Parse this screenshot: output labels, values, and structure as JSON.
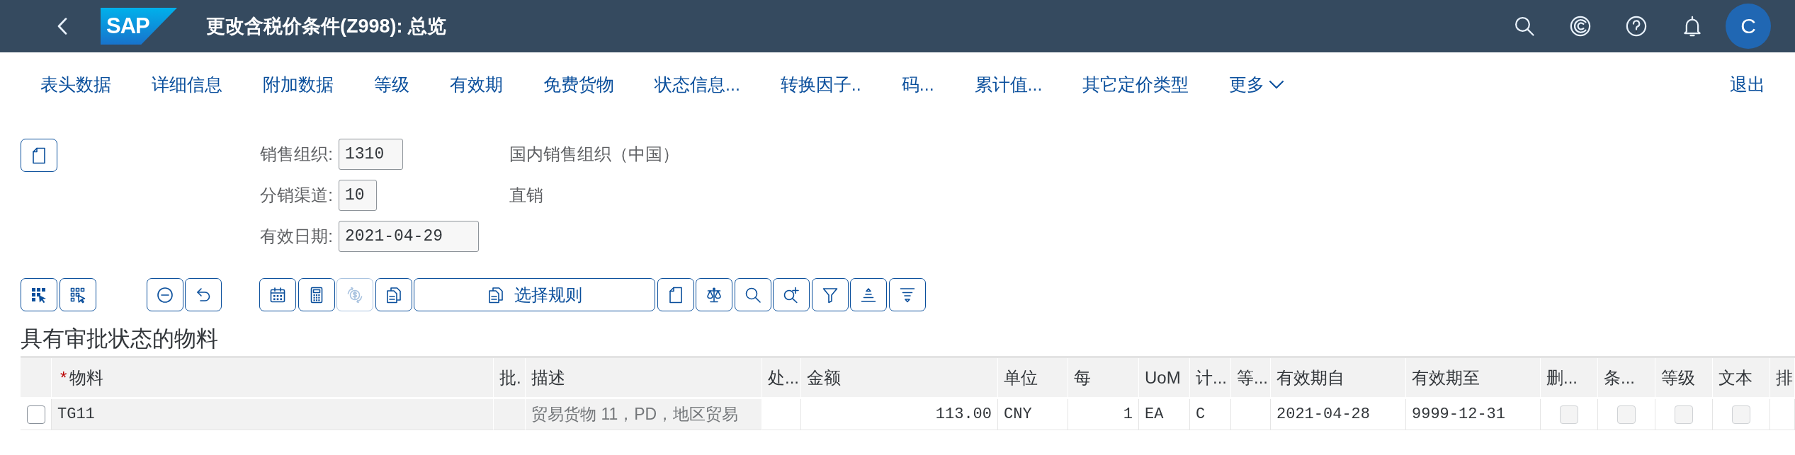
{
  "shell": {
    "logo": "SAP",
    "title": "更改含税价条件(Z998): 总览",
    "avatar": "C"
  },
  "nav": {
    "items": [
      "表头数据",
      "详细信息",
      "附加数据",
      "等级",
      "有效期",
      "免费货物",
      "状态信息...",
      "转换因子..",
      "码...",
      "累计值...",
      "其它定价类型"
    ],
    "more": "更多",
    "exit": "退出"
  },
  "header_form": {
    "rows": [
      {
        "label": "销售组织:",
        "value": "1310",
        "description": "国内销售组织（中国）"
      },
      {
        "label": "分销渠道:",
        "value": "10",
        "description": "直销"
      },
      {
        "label": "有效日期:",
        "value": "2021-04-29"
      }
    ]
  },
  "toolbar": {
    "groups": [
      [
        {
          "disabled": false
        },
        {
          "disabled": false
        }
      ],
      [
        {
          "disabled": false
        },
        {
          "disabled": false
        }
      ],
      [
        {
          "disabled": false
        },
        {
          "disabled": false
        },
        {
          "disabled": true
        },
        {
          "disabled": false
        },
        {
          "disabled": false,
          "label": "选择规则"
        },
        {
          "disabled": false
        },
        {
          "disabled": false
        },
        {
          "disabled": false
        },
        {
          "disabled": false
        },
        {
          "disabled": false
        },
        {
          "disabled": false
        },
        {
          "disabled": false
        }
      ]
    ]
  },
  "table": {
    "title": "具有审批状态的物料",
    "columns": [
      {
        "label": "物料",
        "required_mark": "*"
      },
      {
        "label": "批."
      },
      {
        "label": "描述"
      },
      {
        "label": "处..."
      },
      {
        "label": "金额"
      },
      {
        "label": "单位"
      },
      {
        "label": "每"
      },
      {
        "label": "UoM"
      },
      {
        "label": "计..."
      },
      {
        "label": "等..."
      },
      {
        "label": "有效期自"
      },
      {
        "label": "有效期至"
      },
      {
        "label": "删..."
      },
      {
        "label": "条..."
      },
      {
        "label": "等级"
      },
      {
        "label": "文本"
      },
      {
        "label": "排"
      }
    ],
    "rows": [
      {
        "selected": false,
        "cells": [
          {
            "kind": "readonly",
            "text": "TG11"
          },
          {
            "kind": "readonly"
          },
          {
            "kind": "readonly_dim",
            "text": "贸易货物 11，PD，地区贸易"
          },
          {
            "kind": "field"
          },
          {
            "kind": "number_field",
            "text": "113.00"
          },
          {
            "kind": "field",
            "text": "CNY"
          },
          {
            "kind": "number_field",
            "text": "1"
          },
          {
            "kind": "field",
            "text": "EA"
          },
          {
            "kind": "field",
            "text": "C"
          },
          {
            "kind": "field"
          },
          {
            "kind": "field",
            "text": "2021-04-28"
          },
          {
            "kind": "field",
            "text": "9999-12-31"
          },
          {
            "kind": "checkbox",
            "checked": false,
            "disabled": true
          },
          {
            "kind": "checkbox",
            "checked": false,
            "disabled": true
          },
          {
            "kind": "checkbox",
            "checked": false,
            "disabled": true
          },
          {
            "kind": "checkbox",
            "checked": false,
            "disabled": true
          },
          {
            "kind": "field"
          }
        ]
      }
    ]
  }
}
